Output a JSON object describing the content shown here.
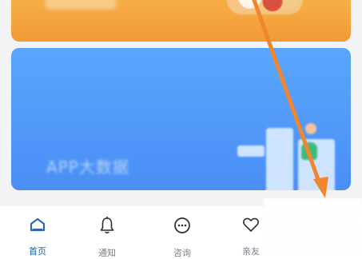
{
  "banner_card": {
    "label": "APP大数据"
  },
  "bottom_nav": {
    "items": [
      {
        "key": "home",
        "label": "首页",
        "icon": "home-icon",
        "active": true
      },
      {
        "key": "notice",
        "label": "通知",
        "icon": "bell-icon",
        "active": false
      },
      {
        "key": "consult",
        "label": "咨询",
        "icon": "chat-bubble-icon",
        "active": false
      },
      {
        "key": "family",
        "label": "亲友",
        "icon": "heart-icon",
        "active": false
      }
    ]
  },
  "colors": {
    "accent_blue": "#2f67b3",
    "banner_blue": "#4a8ef6",
    "banner_orange": "#f39a36",
    "annotation_arrow": "#f0872f"
  }
}
